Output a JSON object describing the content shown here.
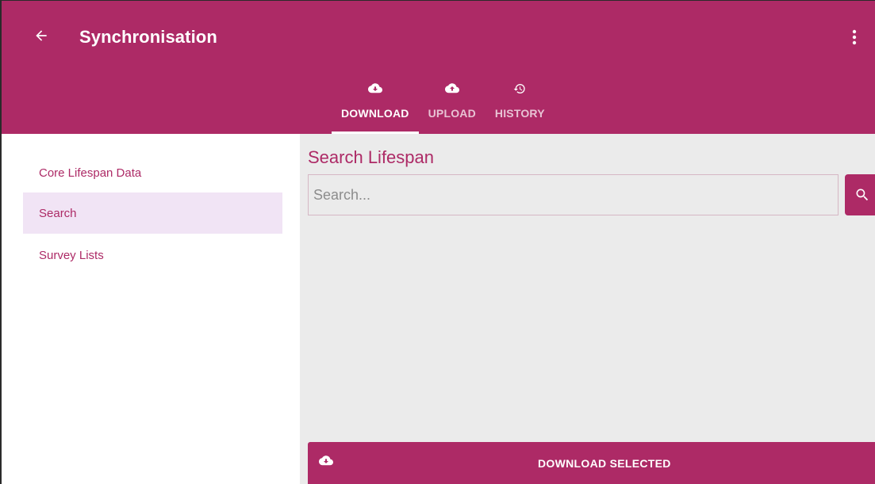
{
  "app": {
    "title": "Synchronisation",
    "back_icon": "arrow-back-icon",
    "menu_icon": "more-vert-icon",
    "accent_color": "#ad2a66"
  },
  "tabs": [
    {
      "label": "DOWNLOAD",
      "icon": "cloud-download-icon",
      "active": true
    },
    {
      "label": "UPLOAD",
      "icon": "cloud-upload-icon",
      "active": false
    },
    {
      "label": "HISTORY",
      "icon": "history-icon",
      "active": false
    }
  ],
  "sidebar": {
    "items": [
      {
        "label": "Core Lifespan Data",
        "selected": false
      },
      {
        "label": "Search",
        "selected": true
      },
      {
        "label": "Survey Lists",
        "selected": false
      }
    ]
  },
  "search": {
    "heading": "Search Lifespan",
    "placeholder": "Search...",
    "value": "",
    "button_icon": "search-icon"
  },
  "actions": {
    "download_selected_label": "DOWNLOAD SELECTED",
    "download_icon": "cloud-download-icon"
  }
}
